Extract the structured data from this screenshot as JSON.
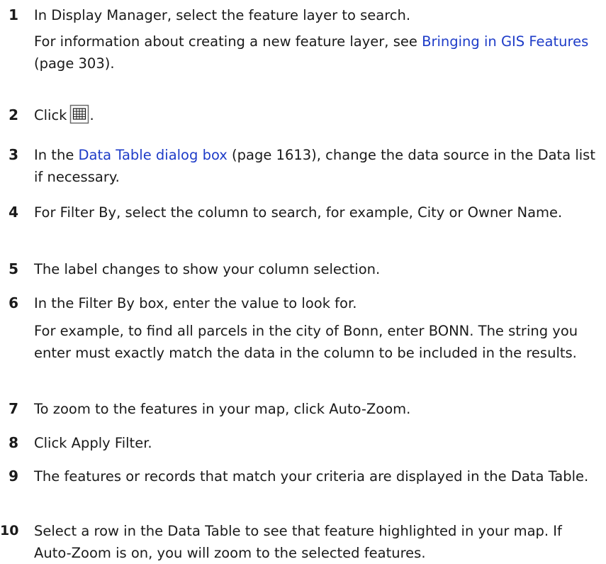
{
  "steps": [
    {
      "number": "1",
      "text": "In Display Manager, select the feature layer to search."
    },
    {
      "note_prefix": "For information about creating a new feature layer, see ",
      "note_link": "Bringing in GIS Features",
      "note_suffix": " (page 303)."
    },
    {
      "number": "2",
      "text": "Click",
      "icon": "data-table-grid-icon",
      "suffix": "."
    },
    {
      "number": "3",
      "prefix": "In the ",
      "link": "Data Table dialog box",
      "suffix": " (page 1613), change the data source in the Data list if necessary."
    },
    {
      "number": "4",
      "text": "For Filter By, select the column to search, for example, City or Owner Name."
    },
    {
      "number": "5",
      "text": "The label changes to show your column selection."
    },
    {
      "number": "6",
      "text": "In the Filter By box, enter the value to look for.",
      "note": "For example, to find all parcels in the city of Bonn, enter BONN. The string you enter must exactly match the data in the column to be included in the results."
    },
    {
      "number": "7",
      "text": "To zoom to the features in your map, click Auto-Zoom."
    },
    {
      "number": "8",
      "text": "Click Apply Filter."
    },
    {
      "number": "9",
      "text": "The features or records that match your criteria are displayed in the Data Table."
    },
    {
      "number": "10",
      "text": "Select a row in the Data Table to see that feature highlighted in your map. If Auto-Zoom is on, you will zoom to the selected features."
    }
  ],
  "colors": {
    "link": "#1e3cc8",
    "text": "#1a1a1a"
  }
}
